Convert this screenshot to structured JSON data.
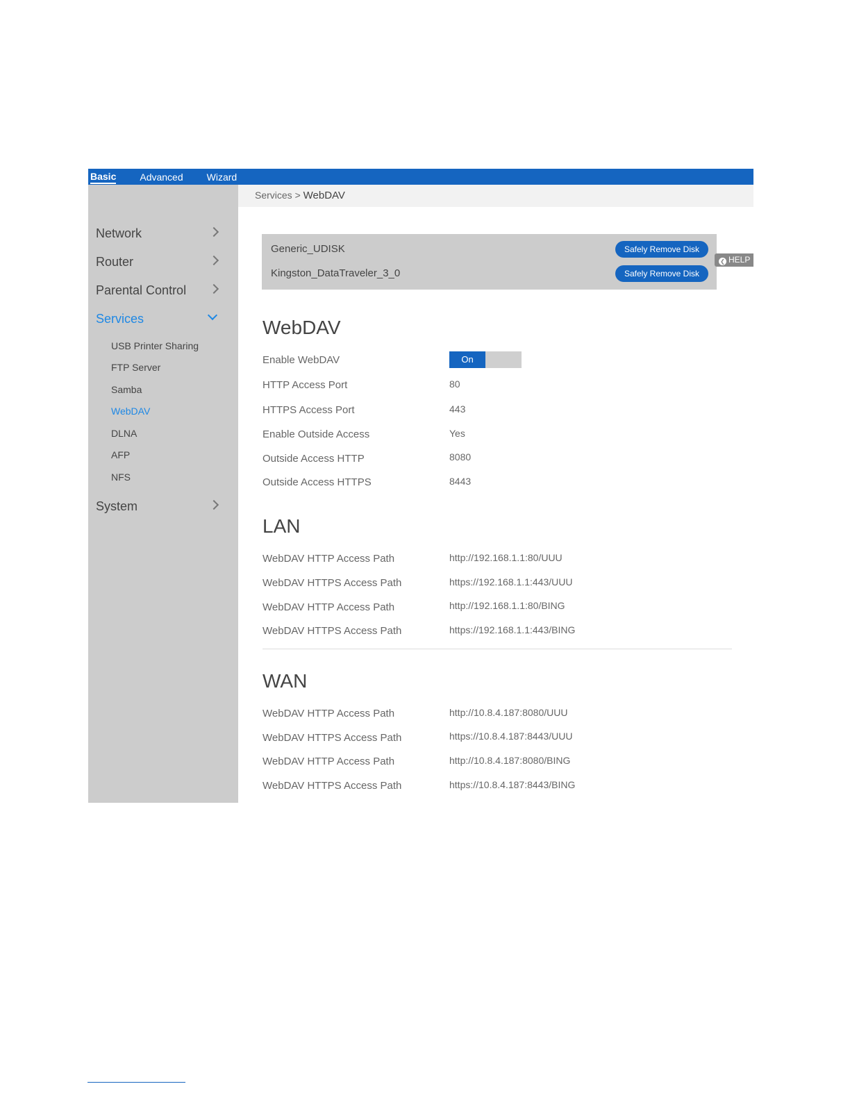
{
  "topbar": {
    "tabs": [
      "Basic",
      "Advanced",
      "Wizard"
    ]
  },
  "sidebar": {
    "network": "Network",
    "router": "Router",
    "parental": "Parental Control",
    "services": "Services",
    "sub": [
      "USB Printer Sharing",
      "FTP Server",
      "Samba",
      "WebDAV",
      "DLNA",
      "AFP",
      "NFS"
    ],
    "system": "System"
  },
  "breadcrumb": {
    "parent": "Services >",
    "current": "WebDAV"
  },
  "disks": [
    {
      "name": "Generic_UDISK",
      "button": "Safely Remove Disk"
    },
    {
      "name": "Kingston_DataTraveler_3_0",
      "button": "Safely Remove Disk"
    }
  ],
  "help": {
    "icon": "chevron-left-icon",
    "label": "HELP"
  },
  "webdav": {
    "title": "WebDAV",
    "enable_label": "Enable WebDAV",
    "enable_state": "On",
    "rows": [
      {
        "label": "HTTP Access Port",
        "value": "80"
      },
      {
        "label": "HTTPS Access Port",
        "value": "443"
      },
      {
        "label": "Enable Outside Access",
        "value": "Yes"
      },
      {
        "label": "Outside Access HTTP",
        "value": "8080"
      },
      {
        "label": "Outside Access HTTPS",
        "value": "8443"
      }
    ]
  },
  "lan": {
    "title": "LAN",
    "rows": [
      {
        "label": "WebDAV HTTP Access Path",
        "value": "http://192.168.1.1:80/UUU"
      },
      {
        "label": "WebDAV HTTPS Access Path",
        "value": "https://192.168.1.1:443/UUU"
      },
      {
        "label": "WebDAV HTTP Access Path",
        "value": "http://192.168.1.1:80/BING"
      },
      {
        "label": "WebDAV HTTPS Access Path",
        "value": "https://192.168.1.1:443/BING"
      }
    ]
  },
  "wan": {
    "title": "WAN",
    "rows": [
      {
        "label": "WebDAV HTTP Access Path",
        "value": "http://10.8.4.187:8080/UUU"
      },
      {
        "label": "WebDAV HTTPS Access Path",
        "value": "https://10.8.4.187:8443/UUU"
      },
      {
        "label": "WebDAV HTTP Access Path",
        "value": "http://10.8.4.187:8080/BING"
      },
      {
        "label": "WebDAV HTTPS Access Path",
        "value": "https://10.8.4.187:8443/BING"
      }
    ]
  },
  "colors": {
    "brand": "#1565c0",
    "active": "#1e88e5",
    "sidebar_bg": "#cccccc"
  }
}
